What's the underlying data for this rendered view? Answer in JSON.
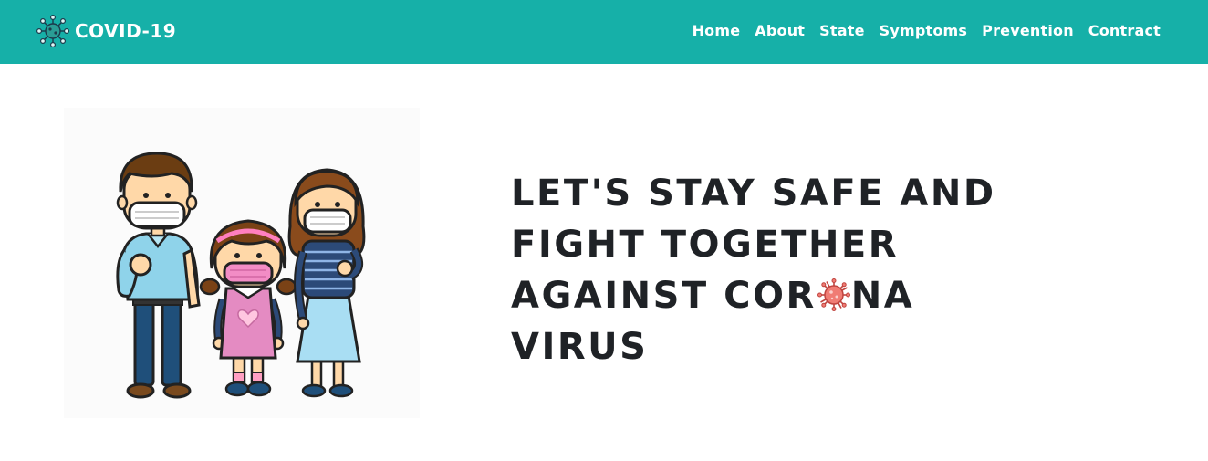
{
  "navbar": {
    "brand_text": "COVID-19",
    "brand_icon": "virus-icon",
    "background": "#16b0a8",
    "links": [
      {
        "label": "Home"
      },
      {
        "label": "About"
      },
      {
        "label": "State"
      },
      {
        "label": "Symptoms"
      },
      {
        "label": "Prevention"
      },
      {
        "label": "Contract"
      }
    ]
  },
  "hero": {
    "illustration": "family-with-masks-illustration",
    "heading": {
      "line1": "LET'S STAY SAFE AND",
      "line2": "FIGHT TOGETHER",
      "line3_before": "AGAINST COR",
      "line3_after": "NA",
      "line4": "VIRUS"
    },
    "heading_color": "#1f2226",
    "virus_color": "#e8605a"
  }
}
